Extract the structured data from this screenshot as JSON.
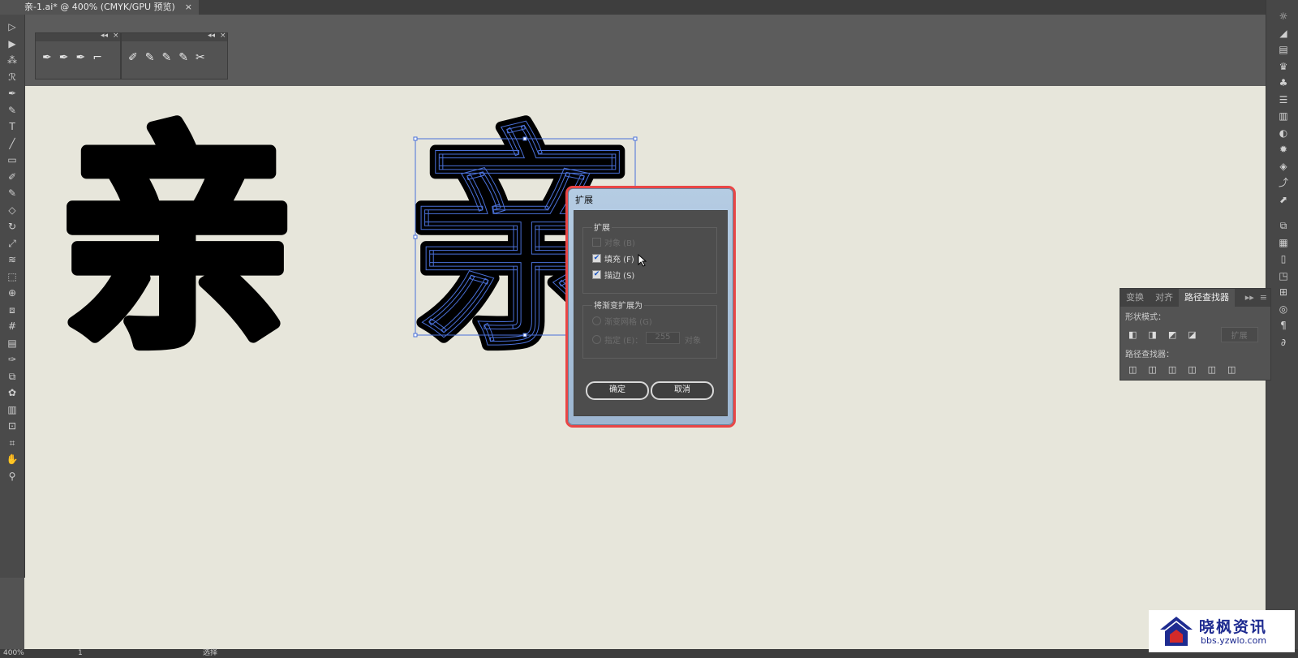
{
  "doc_tab": {
    "title": "亲-1.ai* @ 400% (CMYK/GPU 预览)",
    "close": "×"
  },
  "toolbar": {
    "tools": [
      "selection-tool",
      "direct-selection-tool",
      "magic-wand-tool",
      "lasso-tool",
      "pen-tool",
      "curvature-tool",
      "type-tool",
      "line-tool",
      "rectangle-tool",
      "paintbrush-tool",
      "pencil-tool",
      "eraser-tool",
      "rotate-tool",
      "scale-tool",
      "width-tool",
      "free-transform-tool",
      "shape-builder-tool",
      "perspective-tool",
      "mesh-tool",
      "gradient-tool",
      "eyedropper-tool",
      "blend-tool",
      "symbol-sprayer-tool",
      "column-graph-tool",
      "artboard-tool",
      "slice-tool",
      "hand-tool",
      "zoom-tool"
    ],
    "glyphs": [
      "▷",
      "▶",
      "⁂",
      "ℛ",
      "✒",
      "✎",
      "T",
      "╱",
      "▭",
      "✐",
      "✎",
      "◇",
      "↻",
      "⤢",
      "≋",
      "⬚",
      "⊕",
      "⧈",
      "#",
      "▤",
      "✑",
      "⧉",
      "✿",
      "▥",
      "⊡",
      "⌗",
      "✋",
      "⚲"
    ]
  },
  "pen_panels": [
    {
      "collapse": "◂◂",
      "close": "×",
      "tools": [
        "✒",
        "✒",
        "✒",
        "⌐"
      ]
    },
    {
      "collapse": "◂◂",
      "close": "×",
      "tools": [
        "✐",
        "✎",
        "✎",
        "✎",
        "✂"
      ]
    }
  ],
  "canvas": {
    "glyph": "亲"
  },
  "pathfinder": {
    "tabs": [
      "变换",
      "对齐",
      "路径查找器"
    ],
    "collapse": "▸▸",
    "menu": "≡",
    "shape_modes_label": "形状模式：",
    "pathfinders_label": "路径查找器：",
    "expand_label": "扩展",
    "shape_mode_icons": [
      "◧",
      "◨",
      "◩",
      "◪"
    ],
    "pathfinder_icons": [
      "◫",
      "◫",
      "◫",
      "◫",
      "◫",
      "◫"
    ]
  },
  "dialog": {
    "title": "扩展",
    "expand_group": {
      "legend": "扩展",
      "object": {
        "label": "对象 (B)",
        "checked": false,
        "enabled": false
      },
      "fill": {
        "label": "填充 (F)",
        "checked": true,
        "enabled": true
      },
      "stroke": {
        "label": "描边 (S)",
        "checked": true,
        "enabled": true
      }
    },
    "gradient_group": {
      "legend": "将渐变扩展为",
      "mesh": {
        "label": "渐变网格 (G)"
      },
      "specify": {
        "label": "指定 (E)：",
        "value": "255",
        "unit": "对象"
      }
    },
    "ok_label": "确定",
    "cancel_label": "取消"
  },
  "status_bar": {
    "zoom": "400%",
    "page": "1",
    "mode": "选择"
  },
  "right_dock": {
    "icons": [
      "☼",
      "◢",
      "▤",
      "♛",
      "♣",
      "☰",
      "▥",
      "◐",
      "✹",
      "◈",
      "⤴",
      "⬈",
      "⧉",
      "▦",
      "▯",
      "◳",
      "⊞",
      "◎",
      "¶",
      "∂"
    ]
  },
  "watermark": {
    "title": "晓枫资讯",
    "url": "bbs.yzwlo.com"
  },
  "colors": {
    "artboard": "#e7e6db",
    "glyph": "#000000",
    "selection": "#4a70d8",
    "highlight": "#e94646"
  }
}
